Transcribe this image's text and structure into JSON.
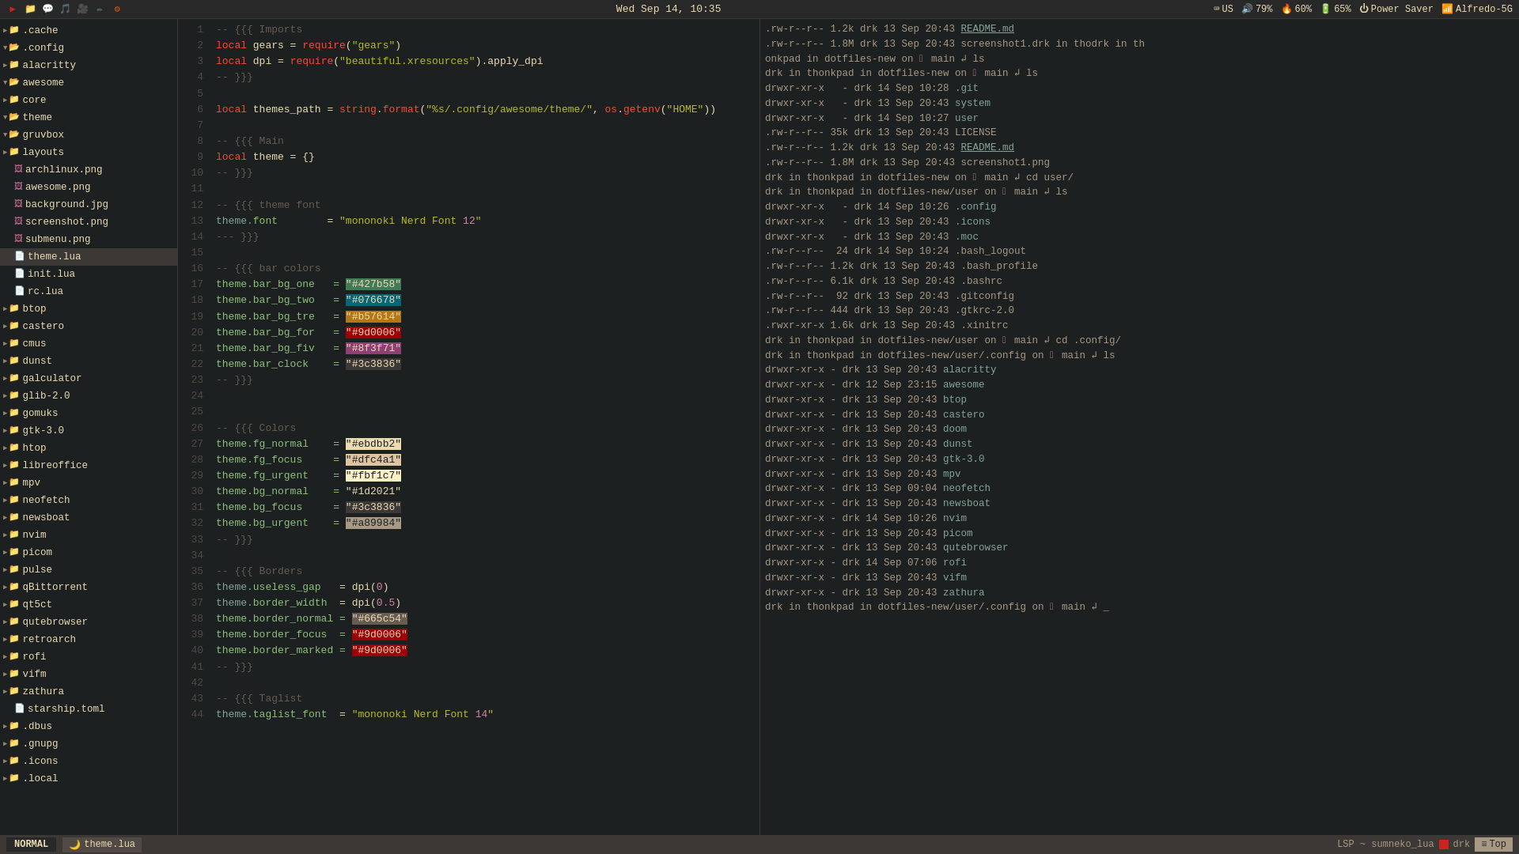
{
  "topbar": {
    "datetime": "Wed Sep 14, 10:35",
    "icons": [
      "▶",
      "📁",
      "💬",
      "🎵",
      "🎥",
      "✏",
      "⚙"
    ],
    "right": {
      "keyboard": "US",
      "volume": "79%",
      "cpu": "60%",
      "battery": "65%",
      "power": "Power Saver",
      "wifi": "Alfredo-5G"
    }
  },
  "sidebar": {
    "items": [
      {
        "indent": 0,
        "arrow": "▶",
        "type": "folder",
        "name": ".cache"
      },
      {
        "indent": 0,
        "arrow": "▼",
        "type": "folder-open",
        "name": ".config"
      },
      {
        "indent": 1,
        "arrow": "▶",
        "type": "folder",
        "name": "alacritty"
      },
      {
        "indent": 1,
        "arrow": "▼",
        "type": "folder-open",
        "name": "awesome"
      },
      {
        "indent": 2,
        "arrow": "▶",
        "type": "folder",
        "name": "core"
      },
      {
        "indent": 2,
        "arrow": "▼",
        "type": "folder-open",
        "name": "theme"
      },
      {
        "indent": 3,
        "arrow": "▼",
        "type": "folder-open",
        "name": "gruvbox"
      },
      {
        "indent": 4,
        "arrow": "▶",
        "type": "folder",
        "name": "layouts"
      },
      {
        "indent": 4,
        "arrow": "",
        "type": "file-png",
        "name": "archlinux.png"
      },
      {
        "indent": 4,
        "arrow": "",
        "type": "file-png",
        "name": "awesome.png"
      },
      {
        "indent": 4,
        "arrow": "",
        "type": "file-jpg",
        "name": "background.jpg"
      },
      {
        "indent": 4,
        "arrow": "",
        "type": "file-png",
        "name": "screenshot.png"
      },
      {
        "indent": 4,
        "arrow": "",
        "type": "file-png",
        "name": "submenu.png"
      },
      {
        "indent": 4,
        "arrow": "",
        "type": "file-lua",
        "name": "theme.lua"
      },
      {
        "indent": 3,
        "arrow": "",
        "type": "file-lua",
        "name": "init.lua"
      },
      {
        "indent": 2,
        "arrow": "",
        "type": "file-lua",
        "name": "rc.lua"
      },
      {
        "indent": 1,
        "arrow": "▶",
        "type": "folder",
        "name": "btop"
      },
      {
        "indent": 1,
        "arrow": "▶",
        "type": "folder",
        "name": "castero"
      },
      {
        "indent": 1,
        "arrow": "▶",
        "type": "folder",
        "name": "cmus"
      },
      {
        "indent": 1,
        "arrow": "▶",
        "type": "folder",
        "name": "dunst"
      },
      {
        "indent": 1,
        "arrow": "▶",
        "type": "folder",
        "name": "galculator"
      },
      {
        "indent": 1,
        "arrow": "▶",
        "type": "folder",
        "name": "glib-2.0"
      },
      {
        "indent": 1,
        "arrow": "▶",
        "type": "folder",
        "name": "gomuks"
      },
      {
        "indent": 1,
        "arrow": "▶",
        "type": "folder",
        "name": "gtk-3.0"
      },
      {
        "indent": 1,
        "arrow": "▶",
        "type": "folder",
        "name": "htop"
      },
      {
        "indent": 1,
        "arrow": "▶",
        "type": "folder",
        "name": "libreoffice"
      },
      {
        "indent": 1,
        "arrow": "▶",
        "type": "folder",
        "name": "mpv"
      },
      {
        "indent": 1,
        "arrow": "▶",
        "type": "folder",
        "name": "neofetch"
      },
      {
        "indent": 1,
        "arrow": "▶",
        "type": "folder",
        "name": "newsboat"
      },
      {
        "indent": 1,
        "arrow": "▶",
        "type": "folder",
        "name": "nvim"
      },
      {
        "indent": 1,
        "arrow": "▶",
        "type": "folder",
        "name": "picom"
      },
      {
        "indent": 1,
        "arrow": "▶",
        "type": "folder",
        "name": "pulse"
      },
      {
        "indent": 1,
        "arrow": "▶",
        "type": "folder",
        "name": "qBittorrent"
      },
      {
        "indent": 1,
        "arrow": "▶",
        "type": "folder",
        "name": "qt5ct"
      },
      {
        "indent": 1,
        "arrow": "▶",
        "type": "folder",
        "name": "qutebrowser"
      },
      {
        "indent": 1,
        "arrow": "▶",
        "type": "folder",
        "name": "retroarch"
      },
      {
        "indent": 1,
        "arrow": "▶",
        "type": "folder",
        "name": "rofi"
      },
      {
        "indent": 1,
        "arrow": "▶",
        "type": "folder",
        "name": "vifm"
      },
      {
        "indent": 1,
        "arrow": "▶",
        "type": "folder",
        "name": "zathura"
      },
      {
        "indent": 1,
        "arrow": "",
        "type": "file-toml",
        "name": "starship.toml"
      },
      {
        "indent": 0,
        "arrow": "▶",
        "type": "folder",
        "name": ".dbus"
      },
      {
        "indent": 0,
        "arrow": "▶",
        "type": "folder",
        "name": ".gnupg"
      },
      {
        "indent": 0,
        "arrow": "▶",
        "type": "folder",
        "name": ".icons"
      },
      {
        "indent": 0,
        "arrow": "▶",
        "type": "folder",
        "name": ".local"
      }
    ]
  },
  "editor": {
    "lines": [
      {
        "num": 1,
        "content": "-- {{{ Imports",
        "type": "comment"
      },
      {
        "num": 2,
        "content": "local gears = require(\"gears\")",
        "type": "code"
      },
      {
        "num": 3,
        "content": "local dpi = require(\"beautiful.xresources\").apply_dpi",
        "type": "code"
      },
      {
        "num": 4,
        "content": "-- }}}",
        "type": "comment"
      },
      {
        "num": 5,
        "content": "",
        "type": "empty"
      },
      {
        "num": 6,
        "content": "local themes_path = string.format(\"%s/.config/awesome/theme/\", os.getenv(\"HOME\"))",
        "type": "code"
      },
      {
        "num": 7,
        "content": "",
        "type": "empty"
      },
      {
        "num": 8,
        "content": "-- {{{ Main",
        "type": "comment"
      },
      {
        "num": 9,
        "content": "local theme = {}",
        "type": "code"
      },
      {
        "num": 10,
        "content": "-- }}}",
        "type": "comment"
      },
      {
        "num": 11,
        "content": "",
        "type": "empty"
      },
      {
        "num": 12,
        "content": "-- {{{ theme font",
        "type": "comment"
      },
      {
        "num": 13,
        "content": "theme.font        = \"mononoki Nerd Font 12\"",
        "type": "code"
      },
      {
        "num": 14,
        "content": "--- }}}",
        "type": "comment"
      },
      {
        "num": 15,
        "content": "",
        "type": "empty"
      },
      {
        "num": 16,
        "content": "-- {{{ bar colors",
        "type": "comment"
      },
      {
        "num": 17,
        "content": "theme.bar_bg_one   = \"#427b58\"",
        "type": "code",
        "highlight": "427b58"
      },
      {
        "num": 18,
        "content": "theme.bar_bg_two   = \"#076678\"",
        "type": "code",
        "highlight": "076678"
      },
      {
        "num": 19,
        "content": "theme.bar_bg_tre   = \"#b57614\"",
        "type": "code",
        "highlight": "b57614"
      },
      {
        "num": 20,
        "content": "theme.bar_bg_for   = \"#9d0006\"",
        "type": "code",
        "highlight": "9d0006"
      },
      {
        "num": 21,
        "content": "theme.bar_bg_fiv   = \"#8f3f71\"",
        "type": "code",
        "highlight": "8f3f71"
      },
      {
        "num": 22,
        "content": "theme.bar_clock    = \"#3c3836\"",
        "type": "code",
        "highlight": "3c3836"
      },
      {
        "num": 23,
        "content": "-- }}}",
        "type": "comment"
      },
      {
        "num": 24,
        "content": "",
        "type": "empty"
      },
      {
        "num": 25,
        "content": "",
        "type": "empty"
      },
      {
        "num": 26,
        "content": "-- {{{ Colors",
        "type": "comment"
      },
      {
        "num": 27,
        "content": "theme.fg_normal    = \"#ebdbb2\"",
        "type": "code",
        "highlight": "ebdbb2"
      },
      {
        "num": 28,
        "content": "theme.fg_focus     = \"#dfc4a1\"",
        "type": "code",
        "highlight": "dfc4a1"
      },
      {
        "num": 29,
        "content": "theme.fg_urgent    = \"#fbf1c7\"",
        "type": "code",
        "highlight": "fbf1c7"
      },
      {
        "num": 30,
        "content": "theme.bg_normal    = \"#1d2021\"",
        "type": "code",
        "highlight": "1d2021"
      },
      {
        "num": 31,
        "content": "theme.bg_focus     = \"#3c3836\"",
        "type": "code",
        "highlight": "3c3836b"
      },
      {
        "num": 32,
        "content": "theme.bg_urgent    = \"#a89984\"",
        "type": "code",
        "highlight": "a89984"
      },
      {
        "num": 33,
        "content": "-- }}}",
        "type": "comment"
      },
      {
        "num": 34,
        "content": "",
        "type": "empty"
      },
      {
        "num": 35,
        "content": "-- {{{ Borders",
        "type": "comment"
      },
      {
        "num": 36,
        "content": "theme.useless_gap   = dpi(0)",
        "type": "code"
      },
      {
        "num": 37,
        "content": "theme.border_width  = dpi(0.5)",
        "type": "code"
      },
      {
        "num": 38,
        "content": "theme.border_normal = \"#665c54\"",
        "type": "code",
        "highlight": "665c54"
      },
      {
        "num": 39,
        "content": "theme.border_focus  = \"#9d0006\"",
        "type": "code",
        "highlight": "9d0006b"
      },
      {
        "num": 40,
        "content": "theme.border_marked = \"#9d0006\"",
        "type": "code",
        "highlight": "9d0006c"
      },
      {
        "num": 41,
        "content": "-- }}}",
        "type": "comment"
      },
      {
        "num": 42,
        "content": "",
        "type": "empty"
      },
      {
        "num": 43,
        "content": "-- {{{ Taglist",
        "type": "comment"
      },
      {
        "num": 44,
        "content": "theme.taglist_font  = \"mononoki Nerd Font 14\"",
        "type": "code"
      }
    ]
  },
  "terminal": {
    "lines": [
      ".rw-r--r-- 1.2k drk 13 Sep 20:43 README.md",
      ".rw-r--r-- 1.8M drk 13 Sep 20:43 screenshot1.drk in thodrk in th",
      "onkpad in dotfiles-new on \\ue0a0 main \\u2937 ls",
      "drk in thonkpad in dotfiles-new on \\ue0a0 main \\u2937 ls",
      "drwxr-xr-x   - drk 14 Sep 10:28 .git",
      "drwxr-xr-x   - drk 13 Sep 20:43 system",
      "drwxr-xr-x   - drk 14 Sep 10:27 user",
      ".rw-r--r-- 35k drk 13 Sep 20:43 LICENSE",
      ".rw-r--r-- 1.2k drk 13 Sep 20:43 README.md",
      ".rw-r--r-- 1.8M drk 13 Sep 20:43 screenshot1.png",
      "drk in thonkpad in dotfiles-new on \\ue0a0 main \\u2937 cd user/",
      "drk in thonkpad in dotfiles-new/user on \\ue0a0 main \\u2937 ls",
      "drwxr-xr-x   - drk 14 Sep 10:26 .config",
      "drwxr-xr-x   - drk 13 Sep 20:43 .icons",
      "drwxr-xr-x   - drk 13 Sep 20:43 .moc",
      ".rw-r--r--  24 drk 14 Sep 10:24 .bash_logout",
      ".rw-r--r-- 1.2k drk 13 Sep 20:43 .bash_profile",
      ".rw-r--r-- 6.1k drk 13 Sep 20:43 .bashrc",
      ".rw-r--r--  92 drk 13 Sep 20:43 .gitconfig",
      ".rw-r--r-- 444 drk 13 Sep 20:43 .gtkrc-2.0",
      ".rwxr-xr-x 1.6k drk 13 Sep 20:43 .xinitrc",
      "drk in thonkpad in dotfiles-new/user on \\ue0a0 main \\u2937 cd .config/",
      "drk in thonkpad in dotfiles-new/user/.config on \\ue0a0 main \\u2937 ls",
      "drwxr-xr-x - drk 13 Sep 20:43 alacritty",
      "drwxr-xr-x - drk 12 Sep 23:15 awesome",
      "drwxr-xr-x - drk 13 Sep 20:43 btop",
      "drwxr-xr-x - drk 13 Sep 20:43 castero",
      "drwxr-xr-x - drk 13 Sep 20:43 doom",
      "drwxr-xr-x - drk 13 Sep 20:43 dunst",
      "drwxr-xr-x - drk 13 Sep 20:43 gtk-3.0",
      "drwxr-xr-x - drk 13 Sep 20:43 mpv",
      "drwxr-xr-x - drk 13 Sep 09:04 neofetch",
      "drwxr-xr-x - drk 13 Sep 20:43 newsboat",
      "drwxr-xr-x - drk 14 Sep 10:26 nvim",
      "drwxr-xr-x - drk 13 Sep 20:43 picom",
      "drwxr-xr-x - drk 13 Sep 20:43 qutebrowser",
      "drwxr-xr-x - drk 14 Sep 07:06 rofi",
      "drwxr-xr-x - drk 13 Sep 20:43 vifm",
      "drwxr-xr-x - drk 13 Sep 20:43 zathura",
      "drk in thonkpad in dotfiles-new/user/.config on \\ue0a0 main \\u2937 _"
    ]
  },
  "statusbar": {
    "mode": "NORMAL",
    "file_icon": "🌙",
    "filename": "theme.lua",
    "lsp": "LSP ~ sumneko_lua",
    "branch_icon": "⎇",
    "branch": "drk",
    "tag": "Top"
  }
}
